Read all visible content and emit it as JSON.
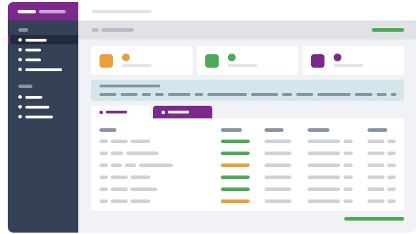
{
  "app": {
    "accent": "#7b2a8c",
    "sidebar_bg": "#344157",
    "success": "#4caa57",
    "warning": "#e8a13a"
  },
  "sidebar": {
    "sections": [
      {
        "items": [
          "",
          "",
          "",
          ""
        ],
        "active_index": 0
      },
      {
        "items": [
          "",
          "",
          ""
        ]
      }
    ]
  },
  "header": {
    "title": ""
  },
  "breadcrumb": {
    "path": ""
  },
  "stats": [
    {
      "icon": "orange-tile-icon",
      "color": "#e8a13a"
    },
    {
      "icon": "green-tile-icon",
      "color": "#4caa57"
    },
    {
      "icon": "purple-tile-icon",
      "color": "#7b2a8c"
    }
  ],
  "tabs": [
    {
      "label": "",
      "active": false
    },
    {
      "label": "",
      "active": true
    }
  ],
  "table": {
    "columns": [
      "",
      "",
      "",
      "",
      ""
    ],
    "rows": [
      {
        "status": "green"
      },
      {
        "status": "green"
      },
      {
        "status": "orange"
      },
      {
        "status": "green"
      },
      {
        "status": "green"
      },
      {
        "status": "orange"
      }
    ]
  }
}
